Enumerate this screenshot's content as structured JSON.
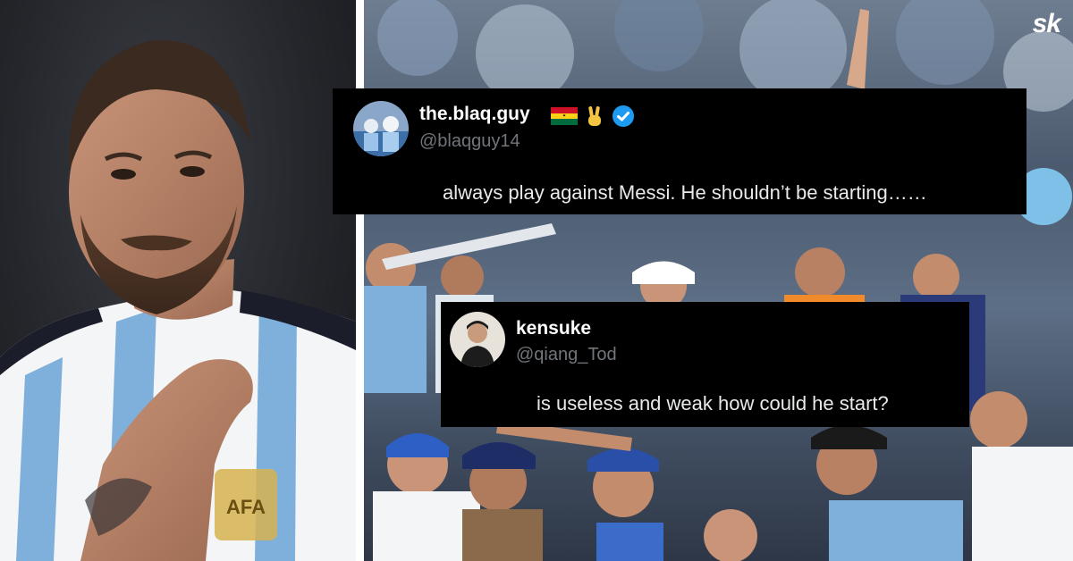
{
  "brand": {
    "logo_text": "sk"
  },
  "photos": {
    "left": {
      "subject": "player-portrait",
      "jersey_colors": [
        "#75aadb",
        "#ffffff",
        "#1b1d2b"
      ]
    },
    "right": {
      "subject": "stadium-crowd"
    }
  },
  "tweets": [
    {
      "display_name": "the.blaq.guy",
      "handle": "@blaqguy14",
      "badges": [
        "ghana-flag-icon",
        "victory-hand-icon",
        "verified-badge-icon"
      ],
      "text": "always play against Messi. He shouldn’t be starting……"
    },
    {
      "display_name": "kensuke",
      "handle": "@qiang_Tod",
      "badges": [],
      "text": "is useless and weak how could he start?"
    }
  ],
  "colors": {
    "tweet_bg": "#000000",
    "handle": "#71767b",
    "verified": "#1d9bf0"
  }
}
